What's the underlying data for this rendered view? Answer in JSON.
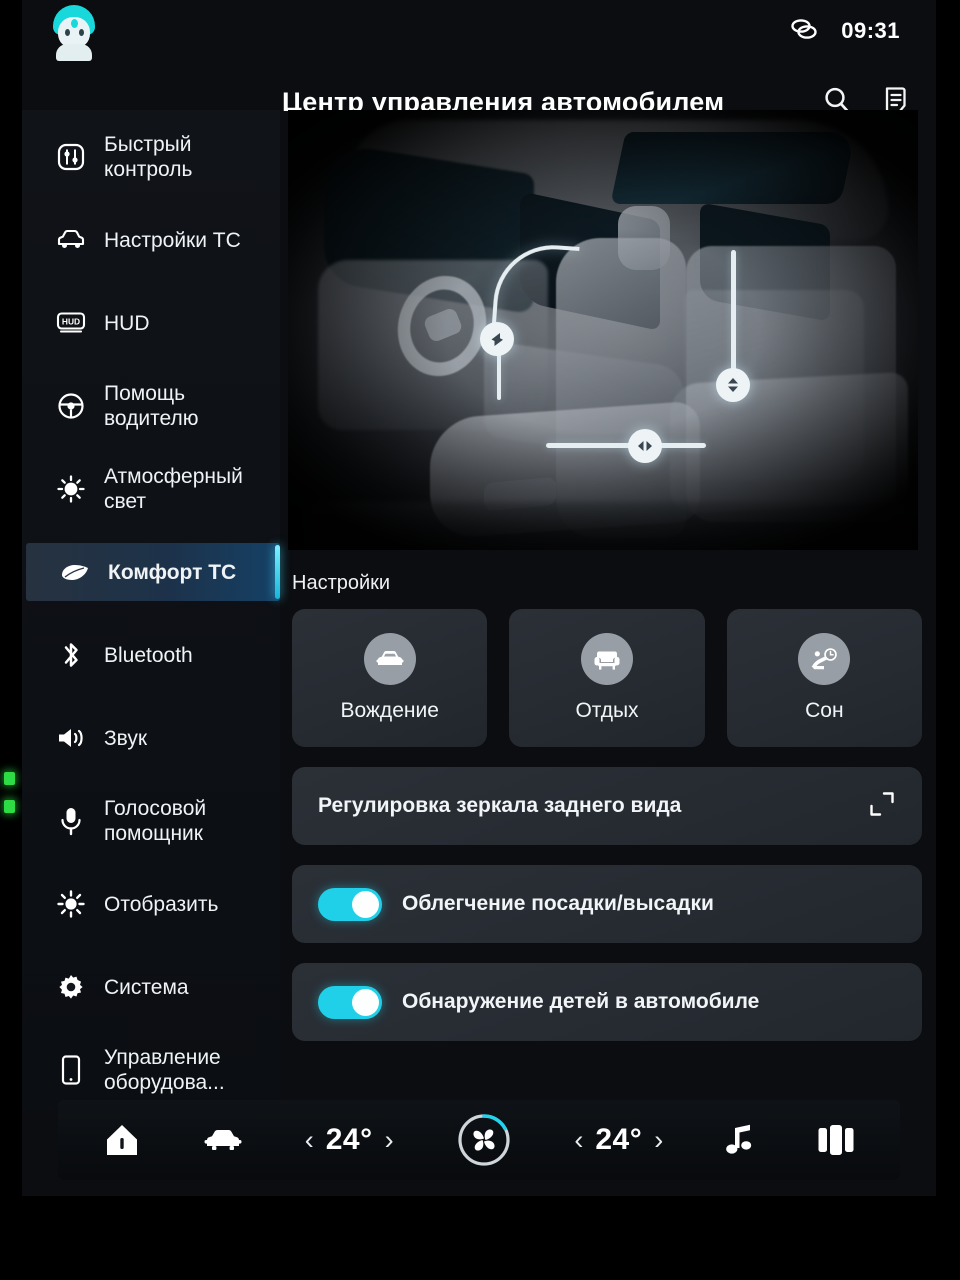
{
  "status_bar": {
    "avatar_name": "user-avatar",
    "link_icon": "link-icon",
    "time": "09:31"
  },
  "header": {
    "title": "Центр управления автомобилем",
    "search_icon": "search-icon",
    "notes_icon": "notes-icon"
  },
  "sidebar": {
    "items": [
      {
        "label": "Быстрый контроль",
        "icon": "sliders-icon",
        "active": false
      },
      {
        "label": "Настройки ТС",
        "icon": "car-icon",
        "active": false
      },
      {
        "label": "HUD",
        "icon": "hud-icon",
        "active": false
      },
      {
        "label": "Помощь водителю",
        "icon": "steering-wheel-icon",
        "active": false
      },
      {
        "label": "Атмосферный свет",
        "icon": "sun-icon",
        "active": false
      },
      {
        "label": "Комфорт ТС",
        "icon": "leaf-icon",
        "active": true
      },
      {
        "label": "Bluetooth",
        "icon": "bluetooth-icon",
        "active": false
      },
      {
        "label": "Звук",
        "icon": "speaker-icon",
        "active": false
      },
      {
        "label": "Голосовой помощник",
        "icon": "microphone-icon",
        "active": false
      },
      {
        "label": "Отобразить",
        "icon": "brightness-icon",
        "active": false
      },
      {
        "label": "Система",
        "icon": "gear-icon",
        "active": false
      },
      {
        "label": "Управление оборудова...",
        "icon": "phone-icon",
        "active": false
      }
    ]
  },
  "main": {
    "hero": {
      "name": "vehicle-interior-render",
      "handles": [
        {
          "name": "seat-backrest-tilt-handle",
          "glyph": "◤"
        },
        {
          "name": "seat-forward-back-handle",
          "glyph": "◀▶"
        },
        {
          "name": "seat-height-handle",
          "glyph": "▲▼"
        }
      ]
    },
    "settings_label": "Настройки",
    "mode_cards": [
      {
        "label": "Вождение",
        "icon": "car-front-icon"
      },
      {
        "label": "Отдых",
        "icon": "armchair-icon"
      },
      {
        "label": "Сон",
        "icon": "reclined-seat-clock-icon"
      }
    ],
    "rows": [
      {
        "label": "Регулировка зеркала заднего вида",
        "type": "link",
        "action_icon": "expand-icon"
      },
      {
        "label": "Облегчение посадки/высадки",
        "type": "toggle",
        "value": "on"
      },
      {
        "label": "Обнаружение детей в автомобиле",
        "type": "toggle",
        "value": "on"
      }
    ]
  },
  "bottom_bar": {
    "home_icon": "home-icon",
    "car_icon": "car-icon",
    "left_temp": "24°",
    "right_temp": "24°",
    "fan_icon": "fan-icon",
    "music_icon": "music-note-icon",
    "apps_icon": "cards-layout-icon",
    "chevron_left": "‹",
    "chevron_right": "›"
  },
  "colors": {
    "accent_cyan": "#1fd0e8",
    "screen_bg": "#0b0d10",
    "card_bg": "#2b3037",
    "text_primary": "#f2f5f7"
  }
}
